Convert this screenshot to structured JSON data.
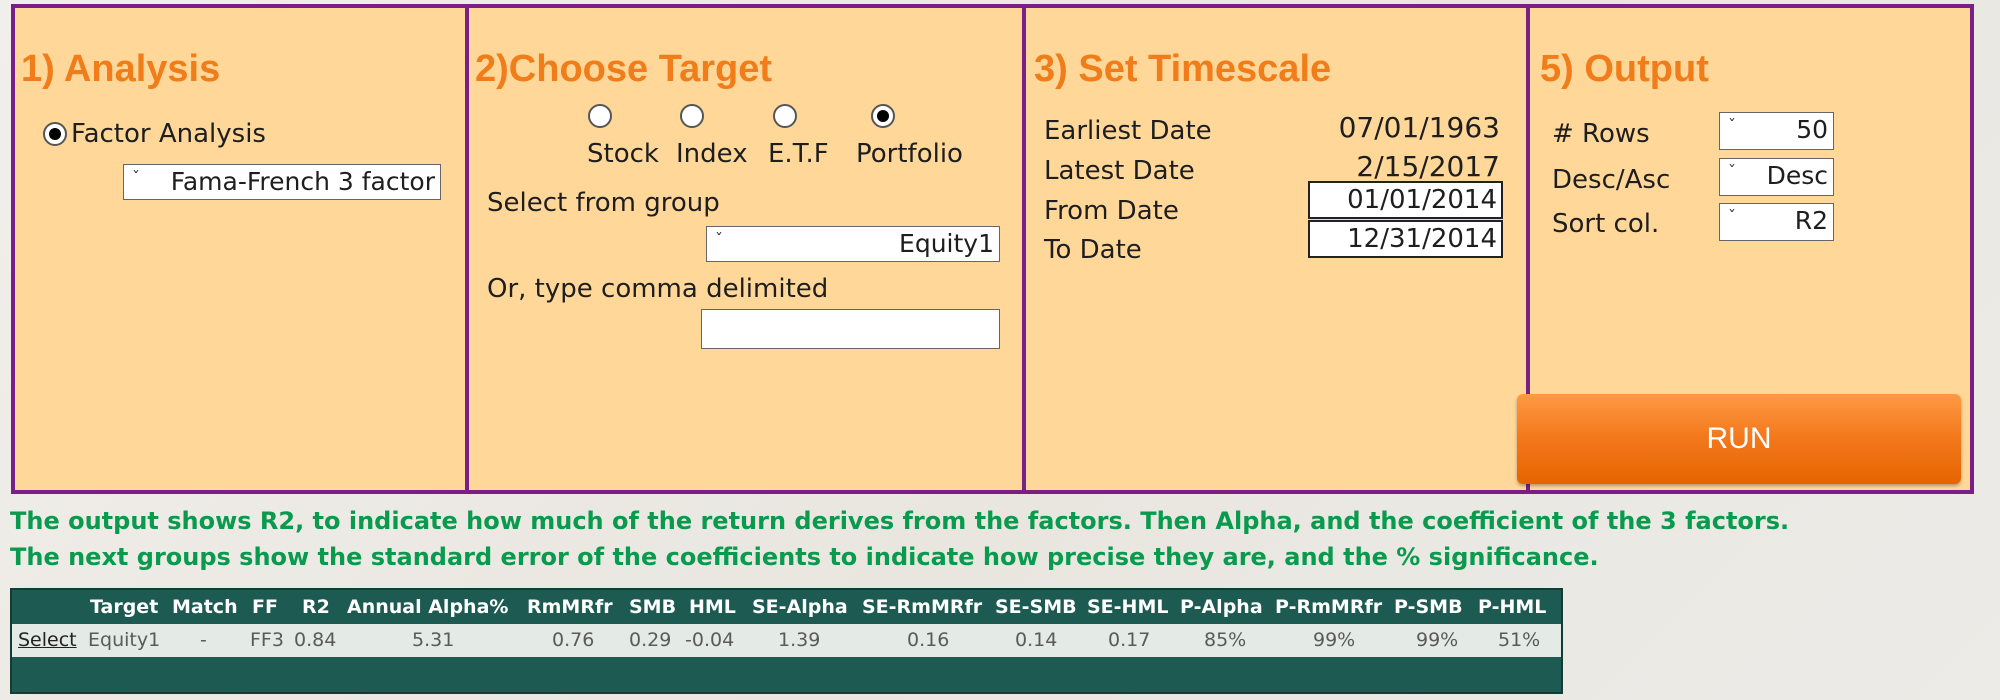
{
  "analysis": {
    "title": "1) Analysis",
    "option_label": "Factor Analysis",
    "model_value": "Fama-French 3 factor"
  },
  "target": {
    "title": "2)Choose Target",
    "radios": [
      {
        "label": "Stock",
        "selected": false
      },
      {
        "label": "Index",
        "selected": false
      },
      {
        "label": "E.T.F",
        "selected": false
      },
      {
        "label": "Portfolio",
        "selected": true
      }
    ],
    "group_label": "Select from group",
    "group_value": "Equity1",
    "type_label": "Or, type comma delimited",
    "type_value": ""
  },
  "timescale": {
    "title": "3) Set Timescale",
    "earliest_label": "Earliest Date",
    "earliest_value": "07/01/1963",
    "latest_label": "Latest Date",
    "latest_value": "2/15/2017",
    "from_label": "From Date",
    "from_value": "01/01/2014",
    "to_label": "To Date",
    "to_value": "12/31/2014"
  },
  "output": {
    "title": "5) Output",
    "rows_label": "# Rows",
    "rows_value": "50",
    "order_label": "Desc/Asc",
    "order_value": "Desc",
    "sort_label": "Sort col.",
    "sort_value": "R2",
    "run_label": "RUN"
  },
  "notes": {
    "line1": "The output shows R2, to indicate how much of the return derives from the factors. Then Alpha, and the coefficient of the 3 factors.",
    "line2": "The next groups show the standard error of the coefficients to indicate how precise they are, and the % significance."
  },
  "results": {
    "headers": [
      "Target",
      "Match",
      "FF",
      "R2",
      "Annual Alpha%",
      "RmMRfr",
      "SMB",
      "HML",
      "SE-Alpha",
      "SE-RmMRfr",
      "SE-SMB",
      "SE-HML",
      "P-Alpha",
      "P-RmMRfr",
      "P-SMB",
      "P-HML"
    ],
    "row": {
      "select": "Select",
      "cells": [
        "Equity1",
        "-",
        "FF3",
        "0.84",
        "5.31",
        "0.76",
        "0.29",
        "-0.04",
        "1.39",
        "0.16",
        "0.14",
        "0.17",
        "85%",
        "99%",
        "99%",
        "51%"
      ]
    }
  },
  "colors": {
    "panel_bg": "#ffd899",
    "panel_border": "#7a1f86",
    "title_orange": "#f07c1a",
    "note_green": "#0a9a4e",
    "table_bg": "#1c5a52",
    "run_button": "#f47a1e"
  }
}
